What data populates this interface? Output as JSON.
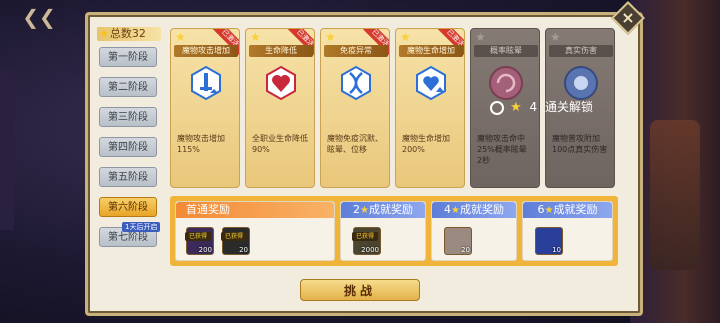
{
  "total": {
    "label": "总数32"
  },
  "stages": [
    {
      "label": "第一阶段"
    },
    {
      "label": "第二阶段"
    },
    {
      "label": "第三阶段"
    },
    {
      "label": "第四阶段"
    },
    {
      "label": "第五阶段"
    },
    {
      "label": "第六阶段",
      "active": true
    },
    {
      "label": "第七阶段",
      "tag": "1天后开启"
    }
  ],
  "cards": [
    {
      "title": "魔物攻击增加",
      "ribbon": "已激活",
      "desc": "魔物攻击增加\n115%",
      "color": "#2c6fd6"
    },
    {
      "title": "生命降低",
      "ribbon": "已激活",
      "desc": "全职业生命降低\n90%",
      "color": "#c8283c"
    },
    {
      "title": "免疫异常",
      "ribbon": "已激活",
      "desc": "魔物免疫沉默、眩晕、位移",
      "color": "#2c6fd6"
    },
    {
      "title": "魔物生命增加",
      "ribbon": "已激活",
      "desc": "魔物生命增加\n200%",
      "color": "#2c6fd6"
    },
    {
      "title": "概率眩晕",
      "desc": "魔物攻击命中\n25%概率眩晕\n2秒",
      "color": "#b44660",
      "locked": true
    },
    {
      "title": "真实伤害",
      "desc": "魔物普攻附加\n100点真实伤害",
      "color": "#3e66b8",
      "locked": true
    }
  ],
  "unlock": {
    "count": "4",
    "text": "通关解锁"
  },
  "rewards": {
    "first": {
      "title": "首通奖励",
      "got_label": "已获得",
      "items": [
        {
          "count": "200",
          "color": "#3b2a5a"
        },
        {
          "count": "20",
          "color": "#2a2a2a"
        }
      ]
    },
    "achievements": [
      {
        "stars": "2",
        "title": "成就奖励",
        "got_label": "已获得",
        "count": "2000",
        "color": "#4a4530"
      },
      {
        "stars": "4",
        "title": "成就奖励",
        "count": "20",
        "color": "#9a8a80"
      },
      {
        "stars": "6",
        "title": "成就奖励",
        "count": "10",
        "color": "#2a3f9a"
      }
    ]
  },
  "challenge": {
    "label": "挑战"
  }
}
